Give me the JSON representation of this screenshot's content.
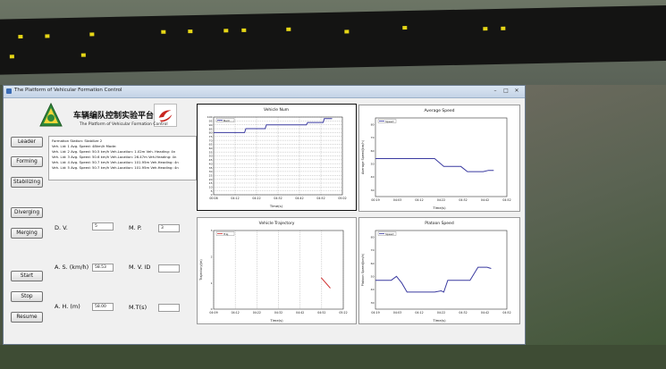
{
  "window": {
    "title": "The Platform of Vehicular Formation Control",
    "controls": [
      "–",
      "□",
      "✕"
    ]
  },
  "header": {
    "cn_title": "车辆编队控制实验平台",
    "en_title": "The Platform of Vehicular Formation Control"
  },
  "mode_buttons": [
    "Leader",
    "Forming",
    "Stabilizing",
    "Diverging",
    "Merging"
  ],
  "action_buttons": [
    "Start",
    "Stop",
    "Resume"
  ],
  "info_lines": [
    "Formation Station: Stabilize 2",
    "Veh. Lid: 1  Avg. Speed: 48km/h        Mode:",
    "Veh. Lid: 2  Avg. Speed: 50.5 km/h   Veh.Location: 1.02m  Veh. Heading: 4n",
    "Veh. Lid: 3  Avg. Speed: 50.6 km/h   Veh.Location: 26.47m  Veh.Heading: 4n",
    "Veh. Lid: 4  Avg. Speed: 50.7 km/h   Veh.Location: 101.95m  Veh.Heading: 4n",
    "Veh. Lid: 5  Avg. Speed: 50.7 km/h   Veh.Location: 101.95m  Veh.Heading: 4n"
  ],
  "fields": {
    "dv": {
      "label": "D. V.",
      "value": "5"
    },
    "mp": {
      "label": "M. P.",
      "value": "3"
    },
    "as": {
      "label": "A. S. (km/h)",
      "value": "58.53"
    },
    "mvid": {
      "label": "M. V. ID",
      "value": ""
    },
    "ah": {
      "label": "A. H. (m)",
      "value": "58.00"
    },
    "mt": {
      "label": "M.T(s)",
      "value": ""
    }
  },
  "chart_data": [
    {
      "type": "line",
      "title": "Vehicle Num",
      "xlabel": "Time(s)",
      "ylabel": "",
      "legend": "Num",
      "x_ticks": [
        "00:08",
        "04:12",
        "04:22",
        "04:32",
        "04:42",
        "04:52",
        "05:02"
      ],
      "y_ticks": [
        "100",
        "95",
        "90",
        "85",
        "80",
        "75",
        "70",
        "65",
        "60",
        "55",
        "50",
        "45",
        "40",
        "35",
        "30",
        "25",
        "20",
        "15",
        "10",
        "5",
        "0"
      ],
      "ylim": [
        0,
        100
      ],
      "grid": true,
      "series": [
        {
          "values": [
            [
              0,
              80
            ],
            [
              0.24,
              80
            ],
            [
              0.25,
              85
            ],
            [
              0.4,
              85
            ],
            [
              0.41,
              90
            ],
            [
              0.72,
              90
            ],
            [
              0.73,
              93
            ],
            [
              0.85,
              93
            ],
            [
              0.86,
              98
            ],
            [
              0.92,
              98
            ]
          ]
        }
      ],
      "color": "#3a3aa0"
    },
    {
      "type": "line",
      "title": "Average Speed",
      "xlabel": "Time(s)",
      "ylabel": "Average Speed(km/h)",
      "legend": "Speed",
      "x_ticks": [
        "00:19",
        "04:03",
        "04:12",
        "04:22",
        "04:32",
        "04:42",
        "04:52"
      ],
      "y_ticks": [
        "80",
        "70",
        "60",
        "50",
        "40",
        "30"
      ],
      "ylim": [
        25,
        85
      ],
      "series": [
        {
          "values": [
            [
              0,
              54
            ],
            [
              0.45,
              54
            ],
            [
              0.52,
              48
            ],
            [
              0.65,
              48
            ],
            [
              0.7,
              44
            ],
            [
              0.82,
              44
            ],
            [
              0.86,
              45
            ],
            [
              0.9,
              45
            ]
          ]
        }
      ],
      "color": "#3a3aa0"
    },
    {
      "type": "line",
      "title": "Vehicle Trajectory",
      "xlabel": "Time(s)",
      "ylabel": "Trajectory(m)",
      "legend": "Traj",
      "x_ticks": [
        "04:09",
        "04:12",
        "04:22",
        "04:32",
        "04:42",
        "04:52",
        "05:22"
      ],
      "y_ticks": [
        "3",
        "2",
        "1",
        "0"
      ],
      "ylim": [
        0,
        3
      ],
      "series": [
        {
          "values": [
            [
              0.83,
              1.2
            ],
            [
              0.9,
              0.8
            ]
          ]
        }
      ],
      "color": "#d03030"
    },
    {
      "type": "line",
      "title": "Platoon Speed",
      "xlabel": "Time(s)",
      "ylabel": "Platoon Speed(km/h)",
      "legend": "Speed",
      "x_ticks": [
        "04:19",
        "04:03",
        "04:12",
        "04:22",
        "04:32",
        "04:42",
        "04:52"
      ],
      "y_ticks": [
        "80",
        "70",
        "60",
        "50",
        "40",
        "30"
      ],
      "ylim": [
        25,
        85
      ],
      "series": [
        {
          "values": [
            [
              0,
              47
            ],
            [
              0.12,
              47
            ],
            [
              0.16,
              50
            ],
            [
              0.2,
              45
            ],
            [
              0.24,
              38
            ],
            [
              0.45,
              38
            ],
            [
              0.5,
              39
            ],
            [
              0.52,
              38
            ],
            [
              0.55,
              47
            ],
            [
              0.72,
              47
            ],
            [
              0.78,
              57
            ],
            [
              0.85,
              57
            ],
            [
              0.88,
              56
            ]
          ]
        }
      ],
      "color": "#3a3aa0"
    }
  ]
}
